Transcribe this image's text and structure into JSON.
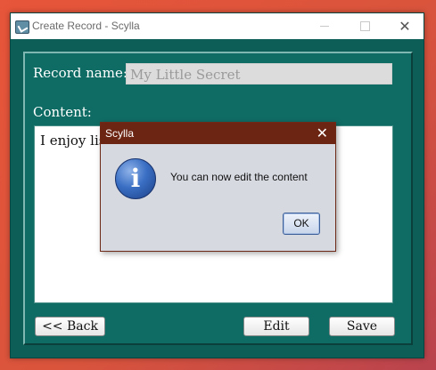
{
  "window": {
    "title": "Create Record - Scylla",
    "minimize_glyph": "",
    "maximize_glyph": "",
    "close_glyph": "✕"
  },
  "form": {
    "record_name_label": "Record name:",
    "record_name_value": "My Little Secret",
    "content_label": "Content:",
    "content_value": "I enjoy lis"
  },
  "buttons": {
    "back": "<< Back",
    "edit": "Edit",
    "save": "Save"
  },
  "dialog": {
    "title": "Scylla",
    "close_glyph": "✕",
    "icon": "info-icon",
    "icon_glyph": "i",
    "message": "You can now edit the content",
    "ok": "OK"
  },
  "colors": {
    "desktop_accent": "#e7553a",
    "window_background": "#0f6c64",
    "dialog_titlebar": "#6c2413",
    "dialog_body": "#d6d9e0"
  }
}
